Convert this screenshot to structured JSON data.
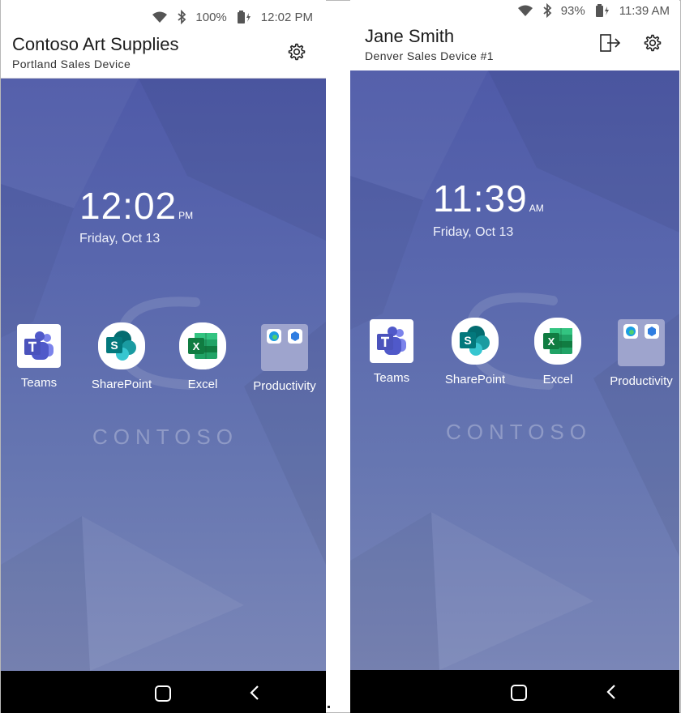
{
  "left": {
    "status": {
      "battery": "100%",
      "time": "12:02 PM"
    },
    "header": {
      "title": "Contoso Art Supplies",
      "subtitle": "Portland Sales Device"
    },
    "clock": {
      "time": "12:02",
      "ampm": "PM",
      "date": "Friday, Oct 13"
    },
    "logo": "CONTOSO",
    "apps": {
      "teams": "Teams",
      "sharepoint": "SharePoint",
      "excel": "Excel",
      "productivity": "Productivity"
    }
  },
  "right": {
    "status": {
      "battery": "93%",
      "time": "11:39 AM"
    },
    "header": {
      "title": "Jane Smith",
      "subtitle": "Denver Sales Device #1"
    },
    "clock": {
      "time": "11:39",
      "ampm": "AM",
      "date": "Friday, Oct 13"
    },
    "logo": "CONTOSO",
    "apps": {
      "teams": "Teams",
      "sharepoint": "SharePoint",
      "excel": "Excel",
      "productivity": "Productivity"
    }
  },
  "icons": {
    "status": [
      "wifi-icon",
      "bluetooth-icon",
      "battery-charging-icon"
    ],
    "header": [
      "settings-gear-icon",
      "sign-out-icon"
    ],
    "nav": [
      "home-icon",
      "back-icon"
    ]
  },
  "colors": {
    "wallpaper_top": "#4f5aa8",
    "wallpaper_bottom": "#7a86b7",
    "teams": "#5059c9",
    "sharepoint": "#038387",
    "excel": "#107c41"
  }
}
